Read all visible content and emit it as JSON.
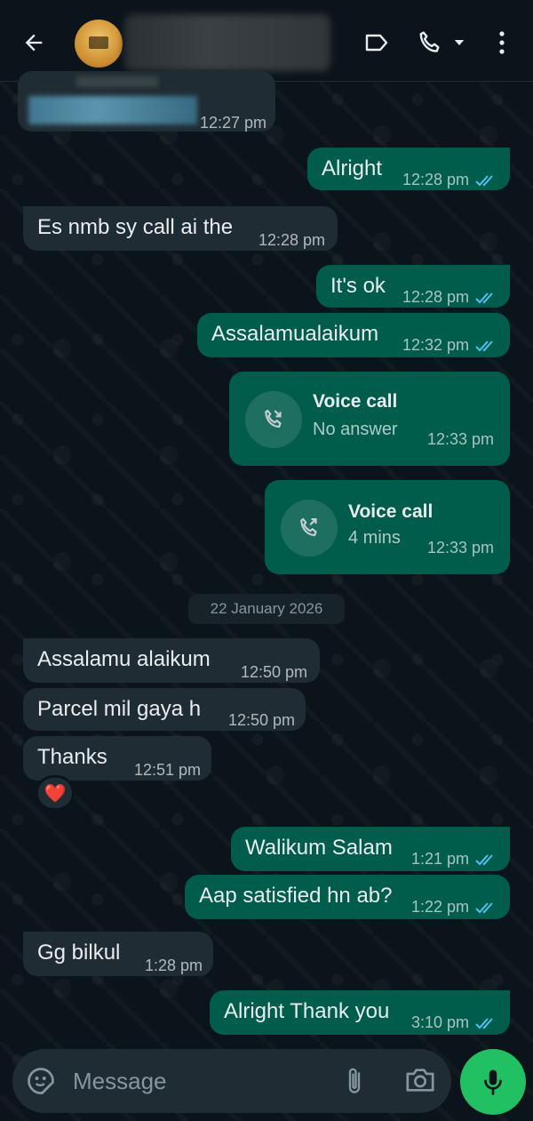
{
  "colors": {
    "header_bg": "#0b141a",
    "incoming_bubble": "#202c33",
    "outgoing_bubble": "#005c4b",
    "read_ticks": "#53bdeb",
    "mic_button": "#21c063"
  },
  "header": {
    "back_icon": "arrow-left-icon",
    "label_icon": "label-tag-icon",
    "call_icon": "phone-icon",
    "dropdown_icon": "caret-down-icon",
    "menu_icon": "more-vertical-icon"
  },
  "messages": [
    {
      "dir": "in",
      "text": "",
      "time": "12:27 pm"
    },
    {
      "dir": "out",
      "text": "Alright",
      "time": "12:28 pm"
    },
    {
      "dir": "in",
      "text": "Es nmb sy call ai the",
      "time": "12:28 pm"
    },
    {
      "dir": "out",
      "text": "It's ok",
      "time": "12:28 pm"
    },
    {
      "dir": "out",
      "text": "Assalamualaikum",
      "time": "12:32 pm"
    },
    {
      "dir": "call",
      "title": "Voice call",
      "subtitle": "No answer",
      "time": "12:33 pm"
    },
    {
      "dir": "call",
      "title": "Voice call",
      "subtitle": "4 mins",
      "time": "12:33 pm"
    },
    {
      "dir": "in",
      "text": "Assalamu alaikum",
      "time": "12:50 pm"
    },
    {
      "dir": "in",
      "text": "Parcel mil gaya h",
      "time": "12:50 pm"
    },
    {
      "dir": "in",
      "text": "Thanks",
      "time": "12:51 pm",
      "reaction": "❤️"
    },
    {
      "dir": "out",
      "text": "Walikum Salam",
      "time": "1:21 pm"
    },
    {
      "dir": "out",
      "text": "Aap satisfied hn ab?",
      "time": "1:22 pm"
    },
    {
      "dir": "in",
      "text": "Gg bilkul",
      "time": "1:28 pm"
    },
    {
      "dir": "out",
      "text": "Alright Thank you",
      "time": "3:10 pm"
    }
  ],
  "date_separator": "22 January 2026",
  "composer": {
    "placeholder": "Message",
    "sticker_icon": "sticker-icon",
    "attach_icon": "paperclip-icon",
    "camera_icon": "camera-icon",
    "mic_icon": "microphone-icon"
  }
}
